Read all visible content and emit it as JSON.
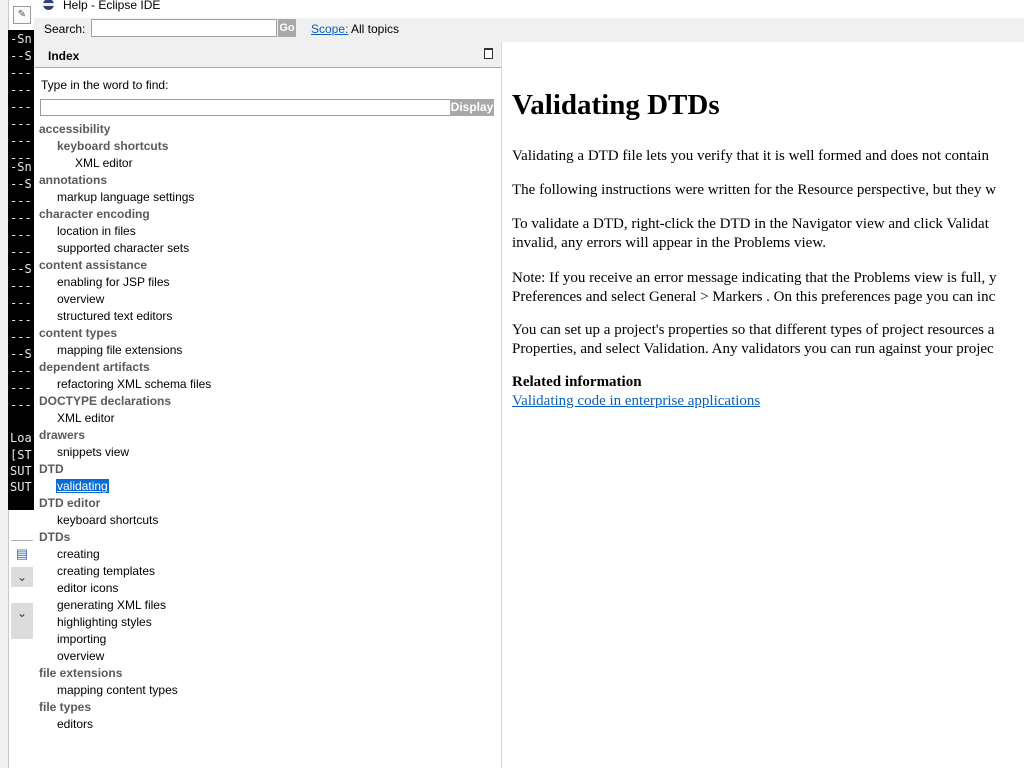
{
  "background_app": {
    "console_lines": [
      "-Sn",
      "--S",
      "---",
      "---",
      "---",
      "---",
      "---",
      "---",
      "-Sn",
      "--S",
      "---",
      "---",
      "---",
      "---",
      "--S",
      "---",
      "---",
      "---",
      "---",
      "--S",
      "---",
      "---",
      "---",
      "Loa",
      "[ST",
      "SUT",
      "SUT"
    ]
  },
  "window": {
    "title": "Help - Eclipse IDE"
  },
  "search": {
    "label": "Search:",
    "value": "",
    "go_label": "Go",
    "scope_link": "Scope:",
    "scope_value": "All topics"
  },
  "index": {
    "title": "Index",
    "find_label": "Type in the word to find:",
    "find_value": "",
    "display_label": "Display",
    "items": [
      {
        "level": 0,
        "text": "accessibility"
      },
      {
        "level": 1,
        "text": "keyboard shortcuts",
        "bold": true
      },
      {
        "level": 2,
        "text": "XML editor"
      },
      {
        "level": 0,
        "text": "annotations"
      },
      {
        "level": 1,
        "text": "markup language settings"
      },
      {
        "level": 0,
        "text": "character encoding"
      },
      {
        "level": 1,
        "text": "location in files"
      },
      {
        "level": 1,
        "text": "supported character sets"
      },
      {
        "level": 0,
        "text": "content assistance"
      },
      {
        "level": 1,
        "text": "enabling for JSP files"
      },
      {
        "level": 1,
        "text": "overview"
      },
      {
        "level": 1,
        "text": "structured text editors"
      },
      {
        "level": 0,
        "text": "content types"
      },
      {
        "level": 1,
        "text": "mapping file extensions"
      },
      {
        "level": 0,
        "text": "dependent artifacts"
      },
      {
        "level": 1,
        "text": "refactoring XML schema files"
      },
      {
        "level": 0,
        "text": "DOCTYPE declarations"
      },
      {
        "level": 1,
        "text": "XML editor"
      },
      {
        "level": 0,
        "text": "drawers"
      },
      {
        "level": 1,
        "text": "snippets view"
      },
      {
        "level": 0,
        "text": "DTD"
      },
      {
        "level": 1,
        "text": "validating",
        "selected": true
      },
      {
        "level": 0,
        "text": "DTD editor"
      },
      {
        "level": 1,
        "text": "keyboard shortcuts"
      },
      {
        "level": 0,
        "text": "DTDs"
      },
      {
        "level": 1,
        "text": "creating"
      },
      {
        "level": 1,
        "text": "creating templates"
      },
      {
        "level": 1,
        "text": "editor icons"
      },
      {
        "level": 1,
        "text": "generating XML files"
      },
      {
        "level": 1,
        "text": "highlighting styles"
      },
      {
        "level": 1,
        "text": "importing"
      },
      {
        "level": 1,
        "text": "overview"
      },
      {
        "level": 0,
        "text": "file extensions"
      },
      {
        "level": 1,
        "text": "mapping content types"
      },
      {
        "level": 0,
        "text": "file types"
      },
      {
        "level": 1,
        "text": "editors"
      }
    ]
  },
  "content": {
    "title": "Validating DTDs",
    "paragraphs": [
      [
        "Validating a DTD file lets you verify that it is well formed and does not contain"
      ],
      [
        "The following instructions were written for the Resource perspective, but they w"
      ],
      [
        "To validate a DTD, right-click the DTD in the Navigator view and click Validat",
        "invalid, any errors will appear in the Problems view."
      ],
      [
        "Note: If you receive an error message indicating that the Problems view is full, y",
        "Preferences and select General > Markers . On this preferences page you can inc"
      ],
      [
        "You can set up a project's properties so that different types of project resources a",
        "Properties, and select Validation. Any validators you can run against your projec"
      ]
    ],
    "related_heading": "Related information",
    "related_link": "Validating code in enterprise applications"
  },
  "colors": {
    "selection": "#0a6bd4",
    "link": "#0a5fbf",
    "button_gray": "#a8a8a8"
  }
}
